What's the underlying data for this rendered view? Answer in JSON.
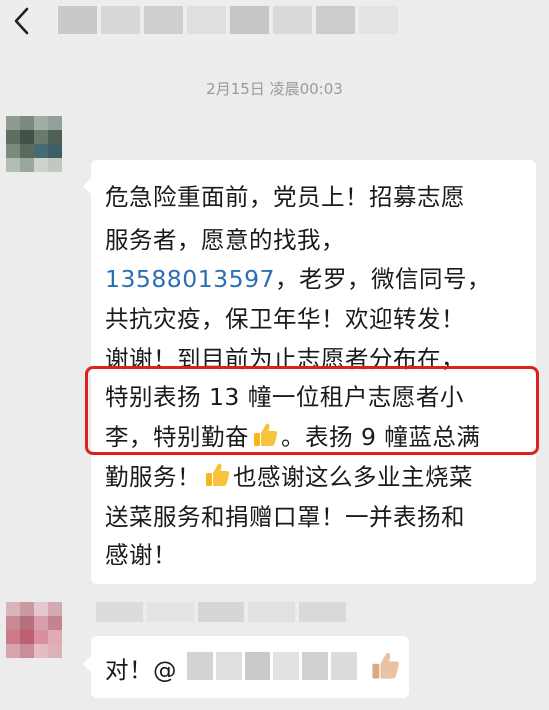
{
  "header": {
    "back_icon": "chevron-left-icon",
    "title_redacted": true
  },
  "timestamp": "2月15日 凌晨00:03",
  "messages": {
    "main": {
      "line1": "危急险重面前，党员上！招募志愿",
      "line2": "服务者，愿意的找我，",
      "phone": "13588013597",
      "line3_rest": "，老罗，微信同号，",
      "line4": "共抗灾疫，保卫年华！欢迎转发！",
      "line5": "谢谢！到目前为止志愿者分布在，",
      "line6": "特别表扬 13 幢一位租户志愿者小",
      "line7a": "李，特别勤奋",
      "line7b": "。表扬 9 幢蓝总满",
      "line8a": "勤服务！",
      "line8b": "也感谢这么多业主烧菜",
      "line9": "送菜服务和捐赠口罩！一并表扬和",
      "line10": "感谢！",
      "emoji": "thumbs-up-icon"
    },
    "reply": {
      "text": "对！@",
      "emoji": "thumbs-up-icon"
    }
  },
  "colors": {
    "background": "#ececec",
    "bubble": "#ffffff",
    "phone_link": "#2b6fb3",
    "highlight_border": "#e0201b",
    "timestamp": "#9a9a9a"
  }
}
